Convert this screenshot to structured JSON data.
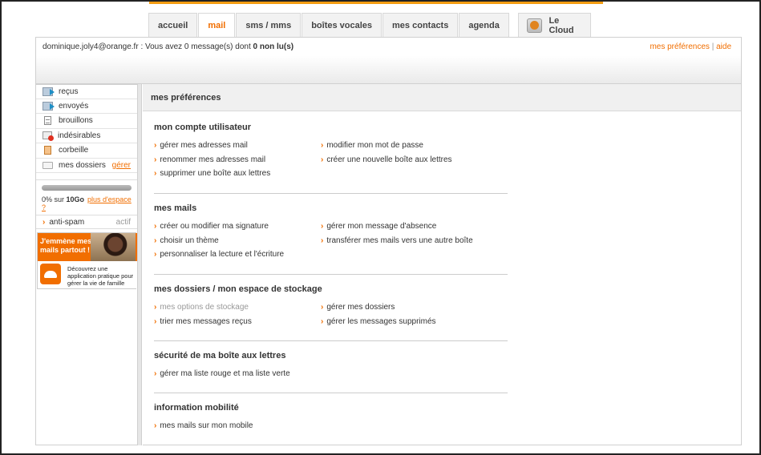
{
  "tabs": [
    {
      "label": "accueil",
      "active": false
    },
    {
      "label": "mail",
      "active": true
    },
    {
      "label": "sms / mms",
      "active": false
    },
    {
      "label": "boîtes vocales",
      "active": false
    },
    {
      "label": "mes contacts",
      "active": false
    },
    {
      "label": "agenda",
      "active": false
    }
  ],
  "cloud_tab": {
    "label": "Le Cloud",
    "icon": "cloud-app-icon"
  },
  "topbar": {
    "email": "dominique.joly4@orange.fr",
    "message_text": " : Vous avez 0 message(s) dont ",
    "unread": "0 non lu(s)",
    "preferences_link": "mes préférences",
    "separator": " | ",
    "help_link": "aide"
  },
  "sidebar": {
    "items": [
      {
        "label": "reçus",
        "icon": "inbox-arrow-icon"
      },
      {
        "label": "envoyés",
        "icon": "sent-arrow-icon"
      },
      {
        "label": "brouillons",
        "icon": "draft-doc-icon"
      },
      {
        "label": "indésirables",
        "icon": "spam-icon"
      },
      {
        "label": "corbeille",
        "icon": "trash-icon"
      },
      {
        "label": "mes dossiers",
        "icon": "folder-icon",
        "action": "gérer"
      }
    ],
    "storage": {
      "used_percent": 0,
      "text_pct": "0% sur ",
      "text_total": "10Go",
      "more_link": "plus d'espace ?"
    },
    "antispam": {
      "label": "anti-spam",
      "status": "actif"
    },
    "promo": {
      "headline": "J'emmène mes mails partout !",
      "body": "Découvrez une application pratique pour gérer la vie de famille"
    }
  },
  "main": {
    "title": "mes préférences",
    "sections": [
      {
        "title": "mon compte utilisateur",
        "left": [
          "gérer mes adresses mail",
          "renommer mes adresses mail",
          "supprimer une boîte aux lettres"
        ],
        "right": [
          "modifier mon mot de passe",
          "créer une nouvelle boîte aux lettres"
        ]
      },
      {
        "title": "mes mails",
        "left": [
          "créer ou modifier ma signature",
          "choisir un thème",
          "personnaliser la lecture et l'écriture"
        ],
        "right": [
          "gérer mon message d'absence",
          "transférer mes mails vers une autre boîte"
        ]
      },
      {
        "title": "mes dossiers / mon espace de stockage",
        "left": [
          "mes options de stockage",
          "trier mes messages reçus"
        ],
        "right": [
          "gérer mes dossiers",
          "gérer les messages supprimés"
        ]
      },
      {
        "title": "sécurité de ma boîte aux lettres",
        "left": [
          "gérer ma liste rouge et ma liste verte"
        ],
        "right": []
      },
      {
        "title": "information mobilité",
        "left": [
          "mes mails sur mon mobile"
        ],
        "right": []
      }
    ]
  },
  "colors": {
    "accent": "#f16e00",
    "top_line": "#f39c12"
  }
}
